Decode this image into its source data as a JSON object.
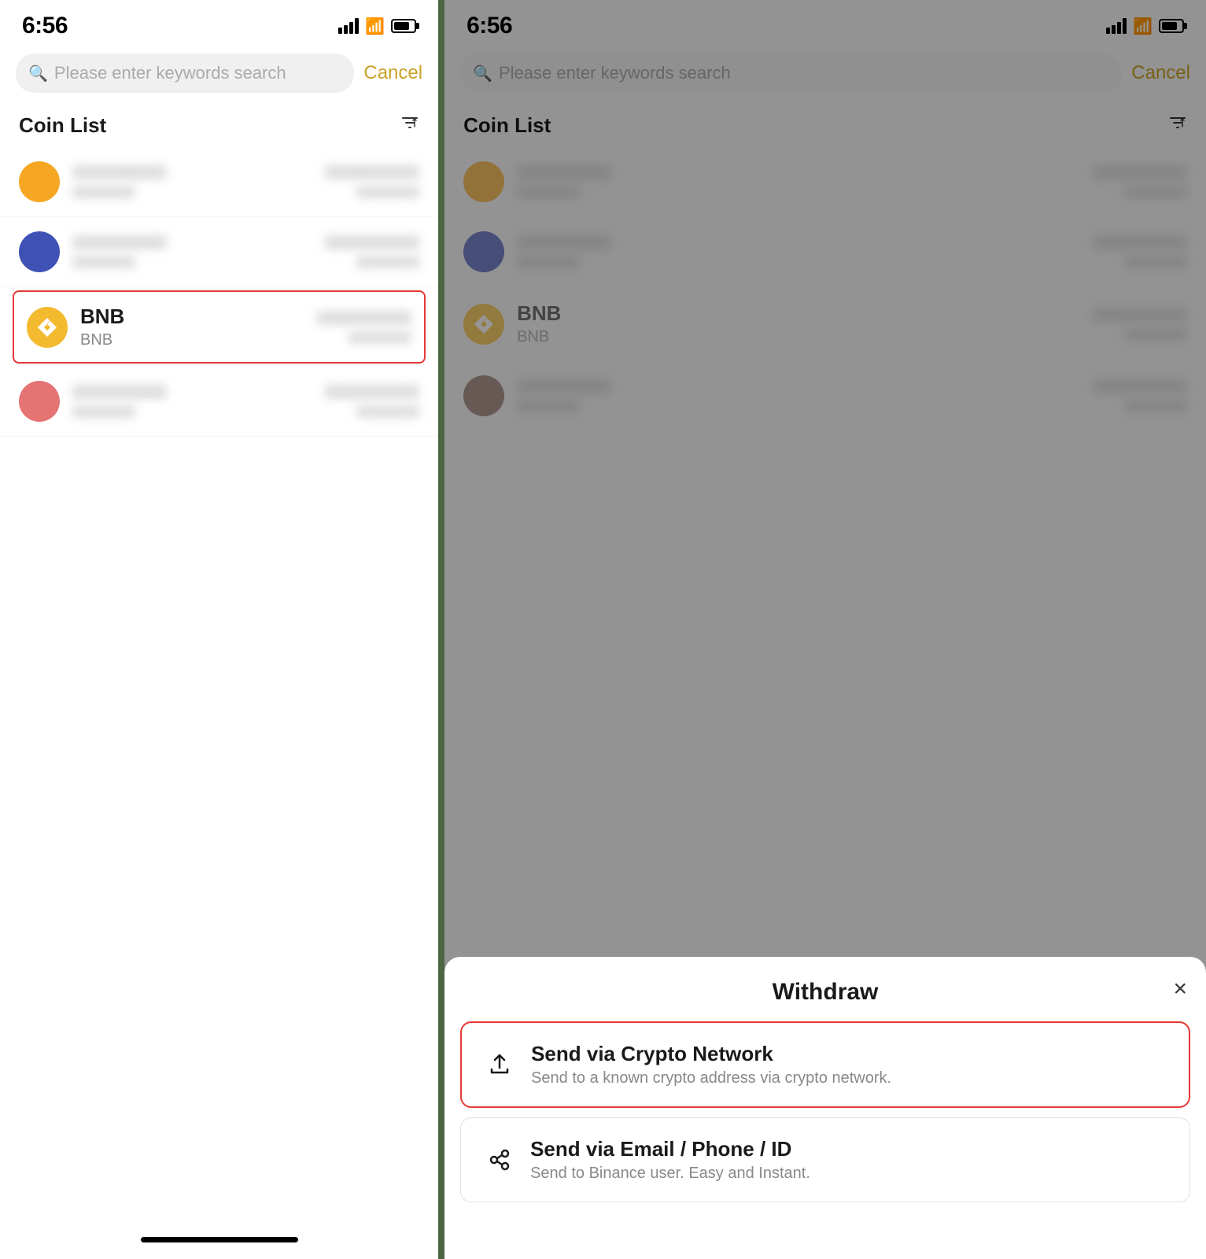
{
  "left": {
    "status": {
      "time": "6:56"
    },
    "search": {
      "placeholder": "Please enter keywords search",
      "cancel_label": "Cancel"
    },
    "coin_list": {
      "title": "Coin List",
      "sort_label": "↕"
    },
    "coins": [
      {
        "id": "coin1",
        "color": "orange",
        "name_blurred": true,
        "selected": false
      },
      {
        "id": "coin2",
        "color": "blue",
        "name_blurred": true,
        "selected": false
      },
      {
        "id": "bnb",
        "color": "bnb",
        "name": "BNB",
        "symbol": "BNB",
        "selected": true
      },
      {
        "id": "coin4",
        "color": "pink",
        "name_blurred": true,
        "selected": false
      }
    ],
    "home_bar": "home-bar"
  },
  "right": {
    "status": {
      "time": "6:56"
    },
    "search": {
      "placeholder": "Please enter keywords search",
      "cancel_label": "Cancel"
    },
    "coin_list": {
      "title": "Coin List",
      "sort_label": "↕"
    },
    "coins": [
      {
        "id": "coin1",
        "color": "orange",
        "name_blurred": true
      },
      {
        "id": "coin2",
        "color": "blue",
        "name_blurred": true
      },
      {
        "id": "bnb",
        "color": "bnb",
        "name": "BNB",
        "symbol": "BNB"
      },
      {
        "id": "coin4",
        "color": "brown",
        "name_blurred": true
      }
    ],
    "modal": {
      "title": "Withdraw",
      "close_label": "×",
      "options": [
        {
          "id": "crypto",
          "title": "Send via Crypto Network",
          "description": "Send to a known crypto address via crypto network.",
          "highlighted": true
        },
        {
          "id": "email",
          "title": "Send via Email / Phone / ID",
          "description": "Send to Binance user. Easy and Instant.",
          "highlighted": false
        }
      ]
    },
    "home_bar": "home-bar"
  }
}
